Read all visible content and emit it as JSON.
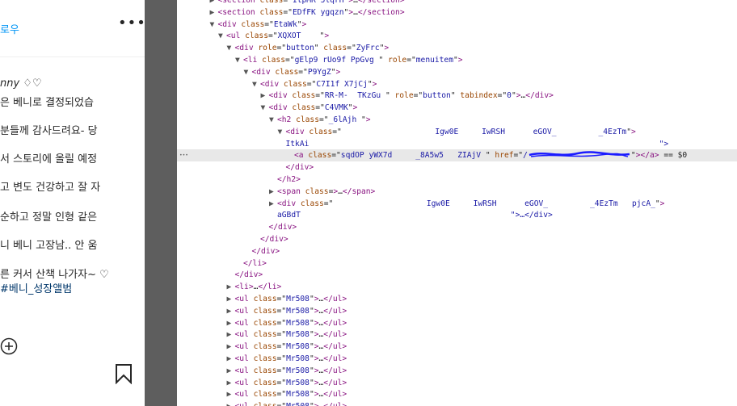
{
  "left": {
    "follow": "로우",
    "more": "•••",
    "captions": [
      "nny ♢♡",
      "은 베니로 결정되었습",
      " 분들께 감사드려요- 당",
      "서 스토리에 올릴 예정",
      "고 변도 건강하고 잘 자",
      " 순하고 정말 인형 같은",
      "니 베니 고장남.. 안 움",
      "른 커서 산책 나가자~ ♡"
    ],
    "hashtag": "#베니_성장앨범"
  },
  "devtools": {
    "lines": [
      {
        "d": 5,
        "tri": "▶",
        "tag": "section",
        "attrs": [
          [
            "class",
            "ItpMR 5lqrH"
          ]
        ],
        "end": "…</section>"
      },
      {
        "d": 5,
        "tri": "▶",
        "tag": "section",
        "attrs": [
          [
            "class",
            "EDfFK ygqzn"
          ]
        ],
        "end": "…</section>"
      },
      {
        "d": 5,
        "tri": "▼",
        "tag": "div",
        "attrs": [
          [
            "class",
            "EtaWk"
          ]
        ],
        "end": ""
      },
      {
        "d": 6,
        "tri": "▼",
        "tag": "ul",
        "attrs": [
          [
            "class",
            "XQXOT    "
          ]
        ],
        "end": ""
      },
      {
        "d": 7,
        "tri": "▼",
        "tag": "div",
        "attrs": [
          [
            "role",
            "button"
          ],
          [
            "class",
            "ZyFrc"
          ]
        ],
        "end": ""
      },
      {
        "d": 8,
        "tri": "▼",
        "tag": "li",
        "attrs": [
          [
            "class",
            "gElp9 rUo9f PpGvg "
          ],
          [
            "role",
            "menuitem"
          ]
        ],
        "end": ""
      },
      {
        "d": 9,
        "tri": "▼",
        "tag": "div",
        "attrs": [
          [
            "class",
            "P9YgZ"
          ]
        ],
        "end": ""
      },
      {
        "d": 10,
        "tri": "▼",
        "tag": "div",
        "attrs": [
          [
            "class",
            "C7I1f X7jCj"
          ]
        ],
        "end": ""
      },
      {
        "d": 11,
        "tri": "▶",
        "tag": "div",
        "attrs": [
          [
            "class",
            "RR-M-  TKzGu "
          ],
          [
            "role",
            "button"
          ],
          [
            "tabindex",
            "0"
          ]
        ],
        "end": "…</div>"
      },
      {
        "d": 11,
        "tri": "▼",
        "tag": "div",
        "attrs": [
          [
            "class",
            "C4VMK"
          ]
        ],
        "end": ""
      },
      {
        "d": 12,
        "tri": "▼",
        "tag": "h2",
        "attrs": [
          [
            "class",
            "_6lAjh "
          ]
        ],
        "end": ""
      },
      {
        "d": 13,
        "tri": "▼",
        "tag": "div",
        "attrs": [
          [
            "class",
            "                    Igw0E     IwRSH      eGOV_         _4EzTm"
          ]
        ],
        "end": ""
      },
      {
        "d": 13,
        "tri": "",
        "text": "ItkAi                                                                           \">",
        "end": ""
      },
      {
        "d": 14,
        "tri": "",
        "tag": "a",
        "attrs": [
          [
            "class",
            "sqdOP yWX7d     _8A5w5   ZIAjV "
          ],
          [
            "href",
            "/"
          ]
        ],
        "end": "</a> == $0",
        "hl": true
      },
      {
        "d": 13,
        "tri": "",
        "close": "div"
      },
      {
        "d": 12,
        "tri": "",
        "close": "h2"
      },
      {
        "d": 12,
        "tri": "▶",
        "tag": "span",
        "attrs": [
          [
            "class",
            ""
          ]
        ],
        "end": "…</span>",
        "bare": true
      },
      {
        "d": 12,
        "tri": "▶",
        "tag": "div",
        "attrs": [
          [
            "class",
            "                    Igw0E     IwRSH      eGOV_         _4EzTm   pjcA_"
          ]
        ],
        "end": ""
      },
      {
        "d": 12,
        "tri": "",
        "text": "aGBdT                                             \">…</div>",
        "end": ""
      },
      {
        "d": 11,
        "tri": "",
        "close": "div"
      },
      {
        "d": 10,
        "tri": "",
        "close": "div"
      },
      {
        "d": 9,
        "tri": "",
        "close": "div"
      },
      {
        "d": 8,
        "tri": "",
        "close": "li"
      },
      {
        "d": 7,
        "tri": "",
        "close": "div"
      },
      {
        "d": 7,
        "tri": "▶",
        "tag": "li",
        "attrs": [],
        "end": "…</li>"
      },
      {
        "d": 7,
        "tri": "▶",
        "tag": "ul",
        "attrs": [
          [
            "class",
            "Mr508"
          ]
        ],
        "end": "…</ul>"
      },
      {
        "d": 7,
        "tri": "▶",
        "tag": "ul",
        "attrs": [
          [
            "class",
            "Mr508"
          ]
        ],
        "end": "…</ul>"
      },
      {
        "d": 7,
        "tri": "▶",
        "tag": "ul",
        "attrs": [
          [
            "class",
            "Mr508"
          ]
        ],
        "end": "…</ul>"
      },
      {
        "d": 7,
        "tri": "▶",
        "tag": "ul",
        "attrs": [
          [
            "class",
            "Mr508"
          ]
        ],
        "end": "…</ul>"
      },
      {
        "d": 7,
        "tri": "▶",
        "tag": "ul",
        "attrs": [
          [
            "class",
            "Mr508"
          ]
        ],
        "end": "…</ul>"
      },
      {
        "d": 7,
        "tri": "▶",
        "tag": "ul",
        "attrs": [
          [
            "class",
            "Mr508"
          ]
        ],
        "end": "…</ul>"
      },
      {
        "d": 7,
        "tri": "▶",
        "tag": "ul",
        "attrs": [
          [
            "class",
            "Mr508"
          ]
        ],
        "end": "…</ul>"
      },
      {
        "d": 7,
        "tri": "▶",
        "tag": "ul",
        "attrs": [
          [
            "class",
            "Mr508"
          ]
        ],
        "end": "…</ul>"
      },
      {
        "d": 7,
        "tri": "▶",
        "tag": "ul",
        "attrs": [
          [
            "class",
            "Mr508"
          ]
        ],
        "end": "…</ul>"
      },
      {
        "d": 7,
        "tri": "▶",
        "tag": "ul",
        "attrs": [
          [
            "class",
            "Mr508"
          ]
        ],
        "end": "…</ul>"
      }
    ],
    "ellipsis": "…"
  },
  "colors": {
    "tag": "#881280",
    "attr": "#994500",
    "value": "#1a1aa6",
    "link": "#0095f6",
    "divider": "#5e5e5e"
  }
}
